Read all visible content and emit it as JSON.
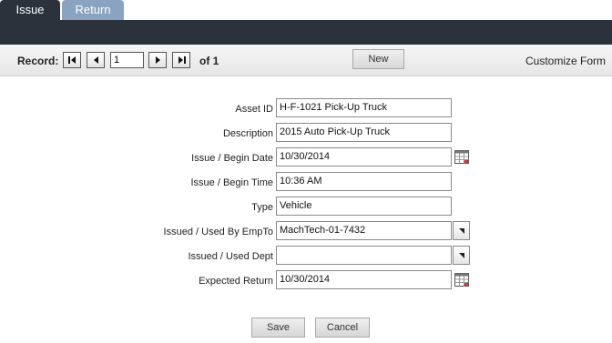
{
  "tabs": [
    {
      "label": "Issue",
      "active": true
    },
    {
      "label": "Return",
      "active": false
    }
  ],
  "record_nav": {
    "label": "Record:",
    "current": "1",
    "total_text": "of 1",
    "new_label": "New",
    "customize_label": "Customize Form"
  },
  "form": {
    "asset_id": {
      "label": "Asset ID",
      "value": "H-F-1021 Pick-Up Truck"
    },
    "description": {
      "label": "Description",
      "value": "2015 Auto Pick-Up Truck"
    },
    "begin_date": {
      "label": "Issue / Begin Date",
      "value": "10/30/2014"
    },
    "begin_time": {
      "label": "Issue / Begin Time",
      "value": "10:36 AM"
    },
    "type": {
      "label": "Type",
      "value": "Vehicle"
    },
    "issued_to": {
      "label": "Issued / Used By EmpTo",
      "value": "MachTech-01-7432"
    },
    "dept": {
      "label": "Issued / Used Dept",
      "value": ""
    },
    "expected_return": {
      "label": "Expected Return",
      "value": "10/30/2014"
    }
  },
  "actions": {
    "save_label": "Save",
    "cancel_label": "Cancel"
  },
  "colors": {
    "header_dark": "#2b323b",
    "tab_inactive": "#8aa3c0"
  }
}
